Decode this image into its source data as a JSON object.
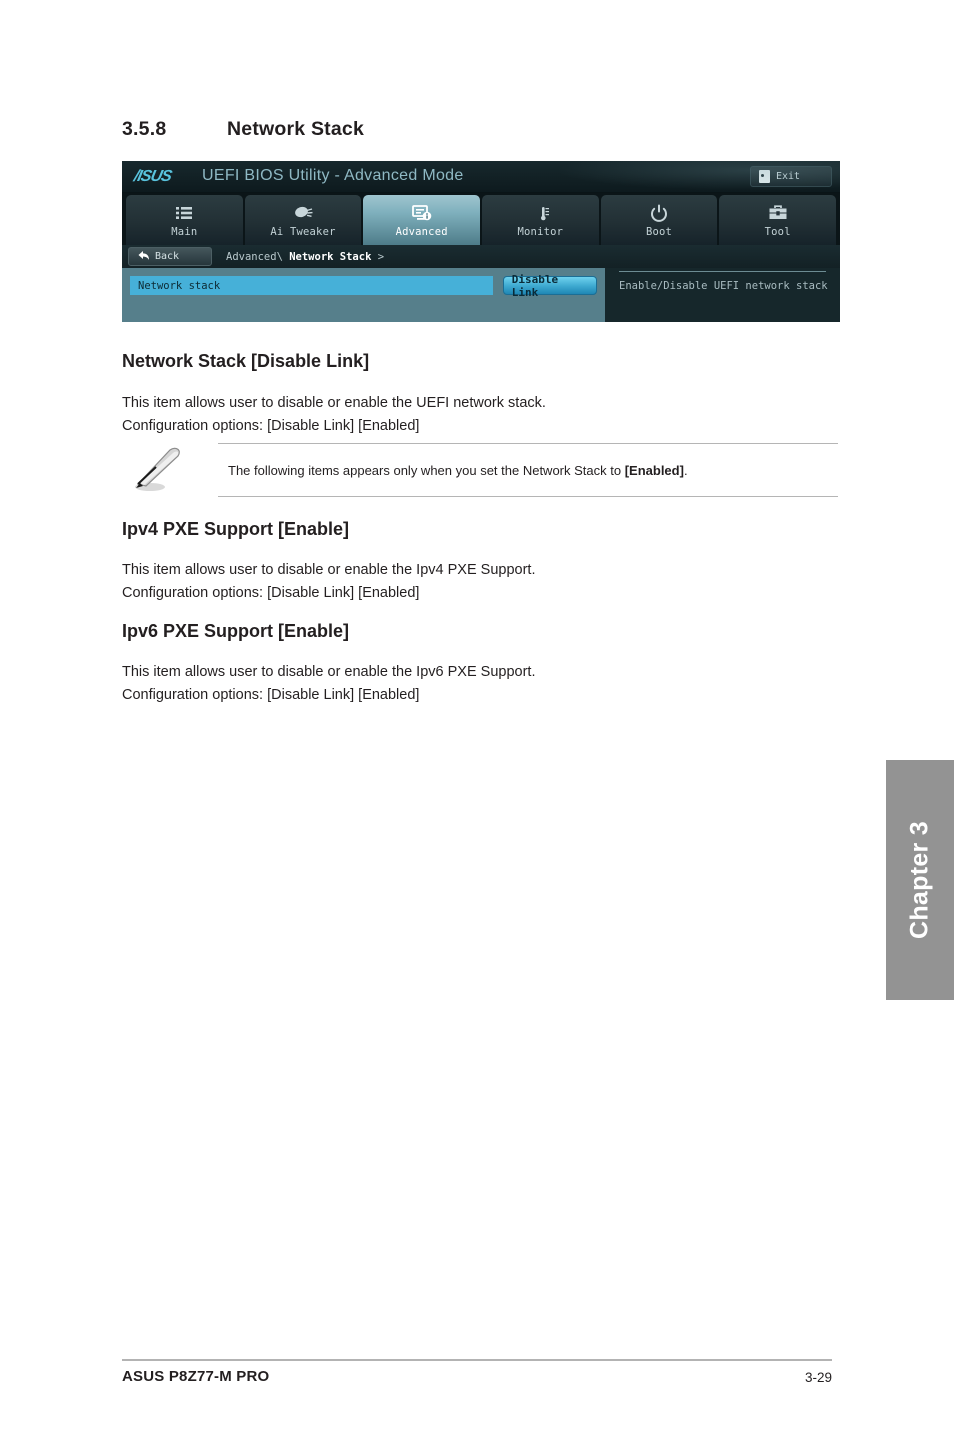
{
  "section": {
    "number": "3.5.8",
    "title": "Network Stack"
  },
  "bios": {
    "logo": "/ISUS",
    "title": "UEFI BIOS Utility - Advanced Mode",
    "exit_label": "Exit",
    "exit_icon": "exit-door-icon",
    "tabs": [
      {
        "label": "Main",
        "icon": "list-icon",
        "active": false
      },
      {
        "label": "Ai Tweaker",
        "icon": "ai-tweaker-icon",
        "active": false
      },
      {
        "label": "Advanced",
        "icon": "advanced-monitor-icon",
        "active": true
      },
      {
        "label": "Monitor",
        "icon": "thermometer-fan-icon",
        "active": false
      },
      {
        "label": "Boot",
        "icon": "power-icon",
        "active": false
      },
      {
        "label": "Tool",
        "icon": "toolbox-icon",
        "active": false
      }
    ],
    "back_label": "Back",
    "back_icon": "back-arrow-icon",
    "breadcrumb_prefix": "Advanced\\ ",
    "breadcrumb_current": "Network Stack",
    "breadcrumb_suffix": " >",
    "setting_name": "Network stack",
    "setting_value": "Disable Link",
    "help_text": "Enable/Disable UEFI network stack",
    "colors": {
      "panel_bg": "#16272b",
      "left_pane": "#567f8b",
      "highlight_row": "#46b0d8",
      "value_button": "#3ca8cf",
      "active_tab": "#7fb0bd"
    }
  },
  "items": [
    {
      "heading": "Network Stack [Disable Link]",
      "body": "This item allows user to disable or enable the UEFI network stack.\nConfiguration options: [Disable Link] [Enabled]"
    },
    {
      "heading": "Ipv4 PXE Support [Enable]",
      "body": "This item allows user to disable or enable the Ipv4 PXE Support.\nConfiguration options: [Disable Link] [Enabled]"
    },
    {
      "heading": "Ipv6 PXE Support [Enable]",
      "body": "This item allows user to disable or enable the Ipv6 PXE Support.\nConfiguration options: [Disable Link] [Enabled]"
    }
  ],
  "note": {
    "icon": "pencil-note-icon",
    "text_before": "The following items appears only when you set the Network Stack to ",
    "text_bold": "[Enabled]",
    "text_after": "."
  },
  "chapter_tab": {
    "label": "Chapter 3"
  },
  "footer": {
    "left": "ASUS P8Z77-M PRO",
    "right": "3-29"
  }
}
